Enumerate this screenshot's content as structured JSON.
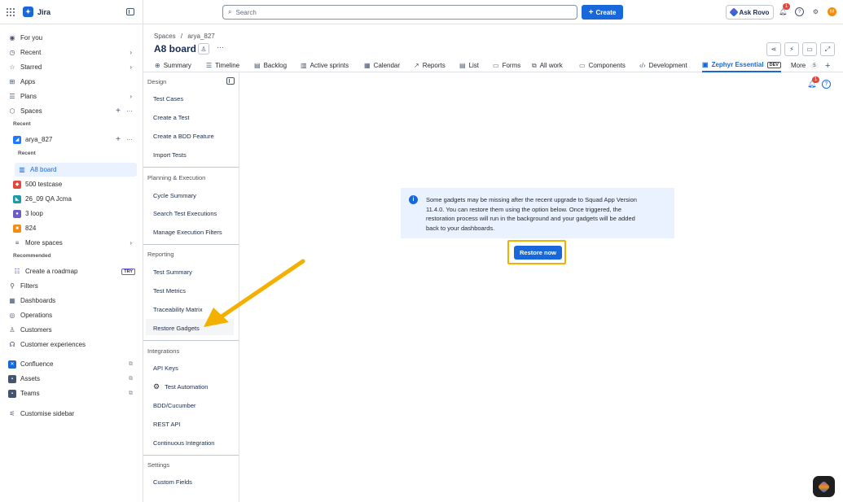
{
  "topbar": {
    "app_name": "Jira",
    "search_placeholder": "Search",
    "create_label": "Create",
    "ask_rovo_label": "Ask Rovo",
    "notifications_count": "1",
    "avatar_initial": "M"
  },
  "sidebar": {
    "items": [
      {
        "label": "For you",
        "icon": "user-circle-icon"
      },
      {
        "label": "Recent",
        "icon": "clock-icon"
      },
      {
        "label": "Starred",
        "icon": "star-icon"
      },
      {
        "label": "Apps",
        "icon": "apps-icon"
      },
      {
        "label": "Plans",
        "icon": "plans-icon"
      },
      {
        "label": "Spaces",
        "icon": "spaces-icon"
      }
    ],
    "recent_label": "Recent",
    "space_current": "arya_827",
    "space_recent_label": "Recent",
    "board_selected": "A8 board",
    "spaces": [
      {
        "label": "500 testcase",
        "color": "#e2483d"
      },
      {
        "label": "26_09 QA Jcma",
        "color": "#1d9aaa"
      },
      {
        "label": "3 loop",
        "color": "#6e5dc6"
      },
      {
        "label": "824",
        "color": "#f18d13"
      }
    ],
    "more_spaces": "More spaces",
    "recommended_label": "Recommended",
    "create_roadmap": "Create a roadmap",
    "try_badge": "TRY",
    "items_bottom": [
      {
        "label": "Filters"
      },
      {
        "label": "Dashboards"
      },
      {
        "label": "Operations"
      },
      {
        "label": "Customers"
      },
      {
        "label": "Customer experiences"
      }
    ],
    "apps": [
      {
        "label": "Confluence"
      },
      {
        "label": "Assets"
      },
      {
        "label": "Teams"
      }
    ],
    "customise": "Customise sidebar"
  },
  "header": {
    "breadcrumb_spaces": "Spaces",
    "breadcrumb_sep": "/",
    "breadcrumb_space": "arya_827",
    "title": "A8 board"
  },
  "tabs": [
    {
      "label": "Summary"
    },
    {
      "label": "Timeline"
    },
    {
      "label": "Backlog"
    },
    {
      "label": "Active sprints"
    },
    {
      "label": "Calendar"
    },
    {
      "label": "Reports"
    },
    {
      "label": "List"
    },
    {
      "label": "Forms"
    },
    {
      "label": "All work"
    },
    {
      "label": "Components"
    },
    {
      "label": "Development"
    },
    {
      "label": "Zephyr Essential",
      "badge": "DEV"
    },
    {
      "label": "More",
      "count": "5"
    }
  ],
  "app_panel": {
    "design": "Design",
    "design_items": [
      "Test Cases",
      "Create a Test",
      "Create a BDD Feature",
      "Import Tests"
    ],
    "planning": "Planning & Execution",
    "planning_items": [
      "Cycle Summary",
      "Search Test Executions",
      "Manage Execution Filters"
    ],
    "reporting": "Reporting",
    "reporting_items": [
      "Test Summary",
      "Test Metrics",
      "Traceability Matrix",
      "Restore Gadgets"
    ],
    "integrations": "Integrations",
    "integrations_items": [
      "API Keys",
      "Test Automation",
      "BDD/Cucumber",
      "REST API",
      "Continuous Integration"
    ],
    "settings": "Settings",
    "settings_items": [
      "Custom Fields"
    ]
  },
  "content": {
    "bell_count": "1",
    "info_line1": "Some gadgets may be missing after the recent upgrade to Squad App Version",
    "info_line2": "11.4.0. You can restore them using the option below. Once triggered, the",
    "info_line3": "restoration process will run in the background and your gadgets will be added",
    "info_line4": "back to your dashboards.",
    "restore_label": "Restore now"
  },
  "colors": {
    "accent": "#1868db",
    "highlight_frame": "#f4b000",
    "arrow": "#f4b000",
    "info_bg": "#e9f2fe"
  }
}
